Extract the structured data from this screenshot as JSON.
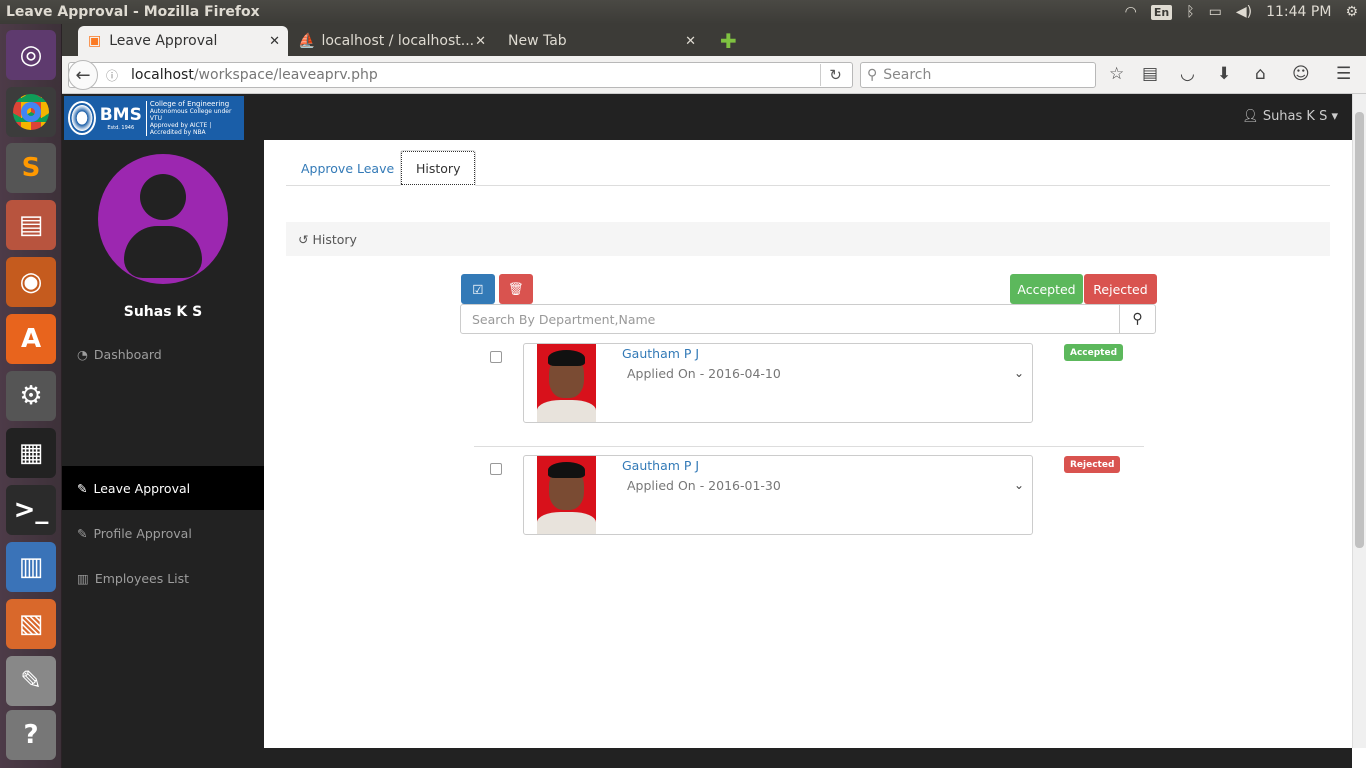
{
  "os": {
    "window_title": "Leave Approval - Mozilla Firefox",
    "keyboard": "En",
    "clock": "11:44 PM"
  },
  "browser": {
    "tabs": [
      {
        "label": "Leave Approval"
      },
      {
        "label": "localhost / localhost..."
      },
      {
        "label": "New Tab"
      }
    ],
    "url_host": "localhost",
    "url_path": "/workspace/leaveaprv.php",
    "search_placeholder": "Search"
  },
  "app": {
    "logo": {
      "name": "BMS",
      "line1": "College of Engineering",
      "line2": "Autonomous College under VTU",
      "line3": "Approved by AICTE | Accredited by NBA",
      "estd": "Estd. 1946"
    },
    "user_menu": "Suhas K S",
    "profile_name": "Suhas K S",
    "sidebar": [
      {
        "label": "Dashboard"
      },
      {
        "label": "Leave Approval"
      },
      {
        "label": "Profile Approval"
      },
      {
        "label": "Employees List"
      }
    ],
    "tabs": [
      {
        "label": "Approve Leave"
      },
      {
        "label": "History"
      }
    ],
    "history_heading": "History",
    "filter_accepted": "Accepted",
    "filter_rejected": "Rejected",
    "search_placeholder": "Search By Department,Name",
    "records": [
      {
        "name": "Gautham P J",
        "applied": "Applied On - 2016-04-10",
        "status": "Accepted"
      },
      {
        "name": "Gautham P J",
        "applied": "Applied On - 2016-01-30",
        "status": "Rejected"
      }
    ]
  },
  "colors": {
    "primary": "#337ab7",
    "success": "#5cb85c",
    "danger": "#d9534f",
    "avatar": "#9c27b0",
    "navbar": "#222222"
  }
}
